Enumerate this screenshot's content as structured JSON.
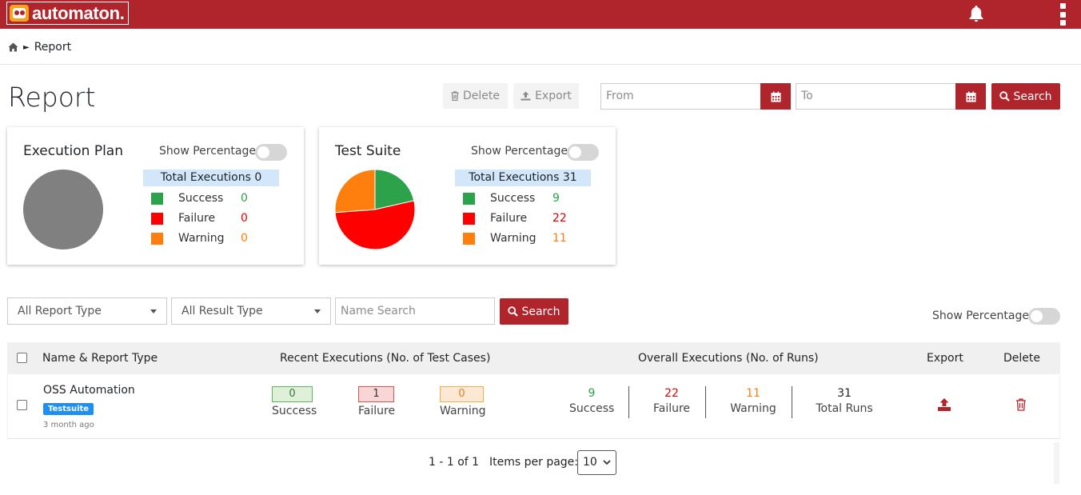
{
  "app": {
    "logo_text": "automaton."
  },
  "colors": {
    "brand": "#b0252b",
    "success": "#2ca24a",
    "failure": "#ff0000",
    "warning": "#ff7f0e",
    "empty": "#808080"
  },
  "breadcrumb": {
    "items": [
      "Report"
    ]
  },
  "page": {
    "title": "Report"
  },
  "toolbar": {
    "delete_label": "Delete",
    "export_label": "Export",
    "from_placeholder": "From",
    "to_placeholder": "To",
    "search_label": "Search"
  },
  "summary_cards": [
    {
      "title": "Execution Plan",
      "show_percentage_label": "Show Percentage",
      "total_label": "Total Executions 0",
      "success_label": "Success",
      "success": 0,
      "failure_label": "Failure",
      "failure": 0,
      "warning_label": "Warning",
      "warning": 0
    },
    {
      "title": "Test Suite",
      "show_percentage_label": "Show Percentage",
      "total_label": "Total Executions 31",
      "success_label": "Success",
      "success": 9,
      "failure_label": "Failure",
      "failure": 22,
      "warning_label": "Warning",
      "warning": 11
    }
  ],
  "filters": {
    "report_type": "All Report Type",
    "result_type": "All Result Type",
    "name_placeholder": "Name Search",
    "search_label": "Search",
    "show_percentage_label": "Show Percentage"
  },
  "table": {
    "headers": {
      "name": "Name & Report Type",
      "recent": "Recent Executions (No. of Test Cases)",
      "overall": "Overall Executions (No. of Runs)",
      "export": "Export",
      "delete": "Delete"
    },
    "rows": [
      {
        "name": "OSS Automation",
        "type": "Testsuite",
        "ago": "3 month ago",
        "recent": {
          "success": "0",
          "failure": "1",
          "warning": "0",
          "success_label": "Success",
          "failure_label": "Failure",
          "warning_label": "Warning"
        },
        "overall": {
          "success": "9",
          "failure": "22",
          "warning": "11",
          "total": "31",
          "success_label": "Success",
          "failure_label": "Failure",
          "warning_label": "Warning",
          "total_label": "Total Runs"
        }
      }
    ]
  },
  "pager": {
    "range": "1 - 1 of 1",
    "items_label": "Items per page:",
    "page_size": "10"
  }
}
